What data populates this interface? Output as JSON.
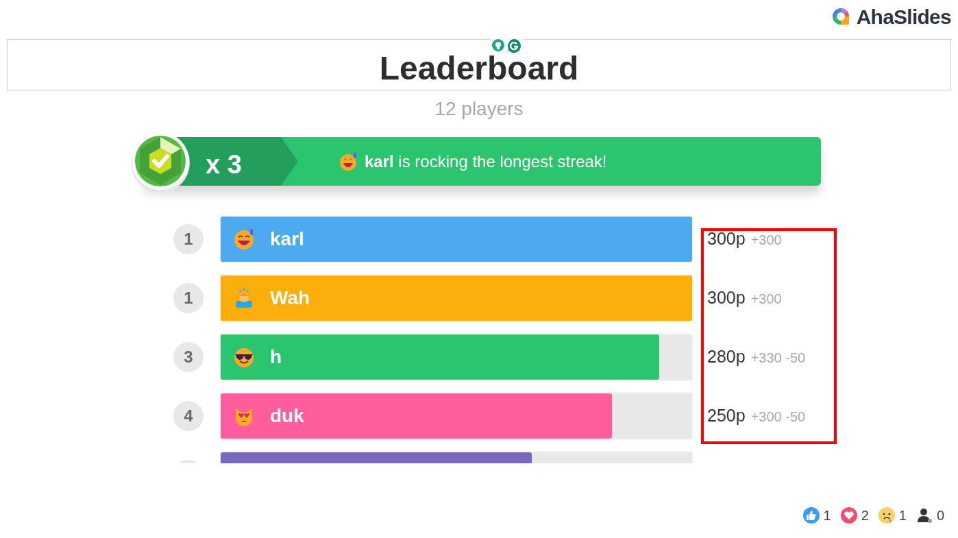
{
  "brand": {
    "name": "AhaSlides"
  },
  "title": "Leaderboard",
  "players": "12 players",
  "streak": {
    "multiplier": "x 3",
    "message": "**karl** is rocking the longest streak!"
  },
  "rows": [
    {
      "rank": "1",
      "name": "karl",
      "color": "#4eaaf0",
      "level": 1,
      "score": "300p",
      "delta": "+300",
      "kind": "grin"
    },
    {
      "rank": "1",
      "name": "Wah",
      "color": "#fcae0d",
      "level": 1,
      "score": "300p",
      "delta": "+300",
      "kind": "bow"
    },
    {
      "rank": "3",
      "name": "h",
      "color": "#2bc46f",
      "level": 0.93,
      "score": "280p",
      "delta": "+330 -50",
      "kind": "cool"
    },
    {
      "rank": "4",
      "name": "duk",
      "color": "#ff5d9e",
      "level": 0.83,
      "score": "250p",
      "delta": "+300 -50",
      "kind": "cat"
    },
    {
      "color": "#7868c0",
      "level": 0.66
    }
  ],
  "reactions": [
    {
      "kind": "like",
      "count": "1"
    },
    {
      "kind": "heart",
      "count": "2"
    },
    {
      "kind": "sad",
      "count": "1"
    },
    {
      "kind": "user",
      "count": "0"
    }
  ]
}
